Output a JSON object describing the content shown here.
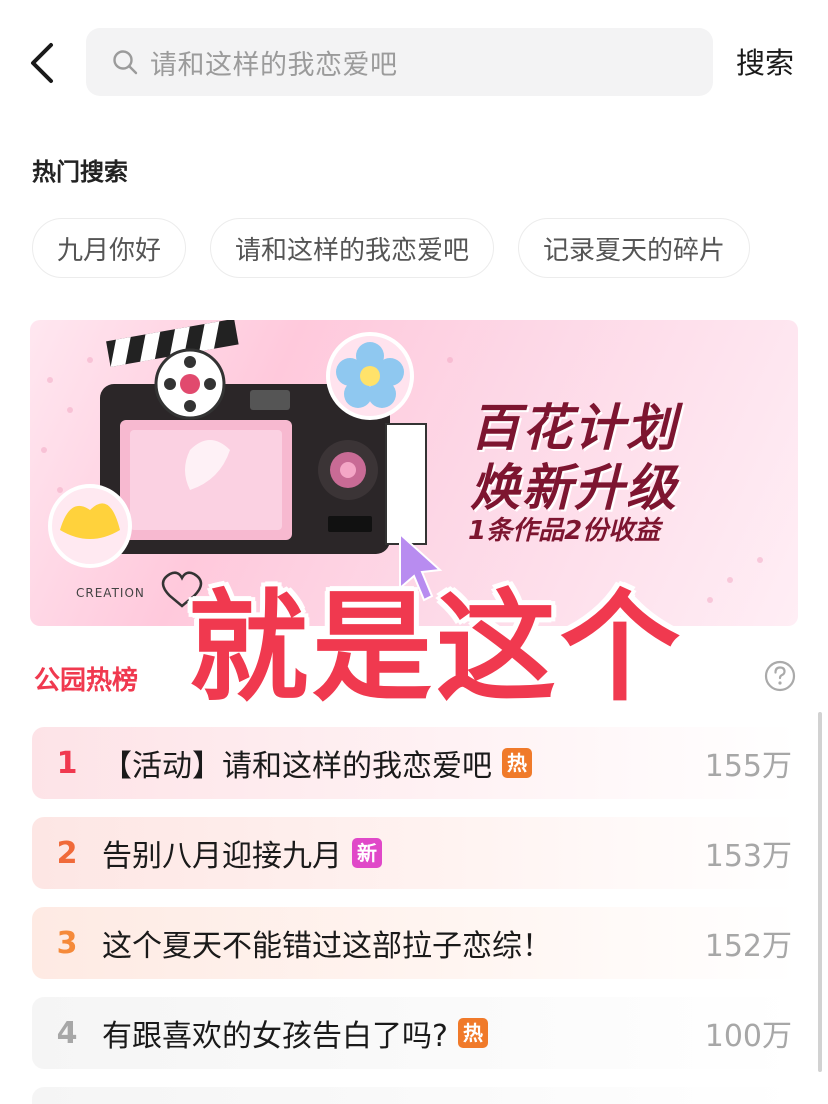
{
  "header": {
    "back_icon": "chevron-left-icon",
    "search_icon": "search-icon",
    "search_placeholder": "请和这样的我恋爱吧",
    "search_button": "搜索"
  },
  "hot_search": {
    "title": "热门搜索",
    "chips": [
      "九月你好",
      "请和这样的我恋爱吧",
      "记录夏天的碎片"
    ]
  },
  "banner": {
    "title_line1": "百花计划",
    "title_line2": "焕新升级",
    "subtitle": "1条作品2份收益",
    "creation_label": "CREATION",
    "accent_color": "#7d1530"
  },
  "overlay": {
    "text": "就是这个",
    "color": "#f0394f"
  },
  "ranking": {
    "title": "公园热榜",
    "help_icon": "question-circle-icon",
    "items": [
      {
        "rank": "1",
        "title": "【活动】请和这样的我恋爱吧",
        "badge": "热",
        "badge_color": "#f07a2a",
        "count": "155万",
        "rank_color": "#f0394f"
      },
      {
        "rank": "2",
        "title": "告别八月迎接九月",
        "badge": "新",
        "badge_color": "#e048c8",
        "count": "153万",
        "rank_color": "#f06a3a"
      },
      {
        "rank": "3",
        "title": "这个夏天不能错过这部拉子恋综！",
        "badge": "",
        "badge_color": "",
        "count": "152万",
        "rank_color": "#f58a3a"
      },
      {
        "rank": "4",
        "title": "有跟喜欢的女孩告白了吗?",
        "badge": "热",
        "badge_color": "#f07a2a",
        "count": "100万",
        "rank_color": "#a7a7a7"
      }
    ]
  }
}
